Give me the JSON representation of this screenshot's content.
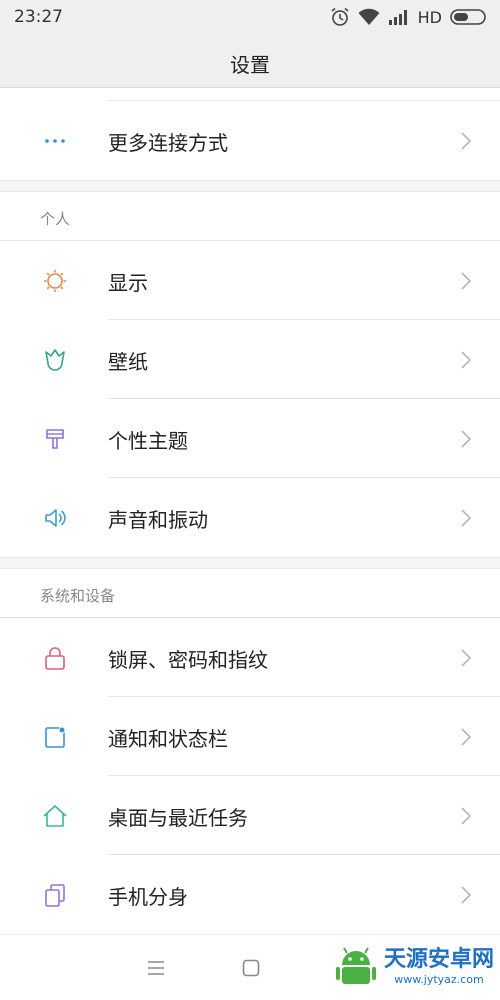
{
  "status_bar": {
    "time": "23:27",
    "network_label": "HD"
  },
  "header": {
    "title": "设置"
  },
  "rows_top": [
    {
      "label": "更多连接方式",
      "icon": "more-dots-icon",
      "color": "#3b8fd3"
    }
  ],
  "section_personal": {
    "header": "个人",
    "items": [
      {
        "label": "显示",
        "icon": "sun-icon",
        "color": "#e48a4b"
      },
      {
        "label": "壁纸",
        "icon": "tulip-icon",
        "color": "#3aa386"
      },
      {
        "label": "个性主题",
        "icon": "brush-icon",
        "color": "#8c76d9"
      },
      {
        "label": "声音和振动",
        "icon": "speaker-icon",
        "color": "#3aa0cf"
      }
    ]
  },
  "section_system": {
    "header": "系统和设备",
    "items": [
      {
        "label": "锁屏、密码和指纹",
        "icon": "lock-icon",
        "color": "#d9607a"
      },
      {
        "label": "通知和状态栏",
        "icon": "notification-icon",
        "color": "#3a8fd3"
      },
      {
        "label": "桌面与最近任务",
        "icon": "home-icon",
        "color": "#3bb5a0"
      },
      {
        "label": "手机分身",
        "icon": "dual-icon",
        "color": "#8c76d9"
      }
    ]
  },
  "watermark": {
    "text": "天源安卓网",
    "url": "www.jytyaz.com"
  }
}
